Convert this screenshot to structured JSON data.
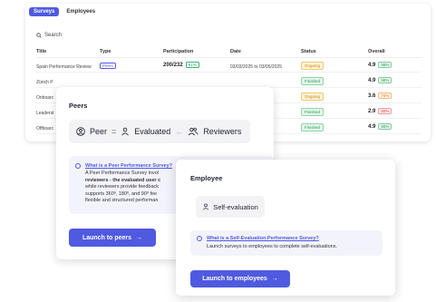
{
  "tabs": [
    "Surveys",
    "Employees"
  ],
  "search": {
    "label": "Search"
  },
  "table": {
    "columns": [
      "Title",
      "Type",
      "Participation",
      "Date",
      "Status",
      "Overall"
    ],
    "rows": [
      {
        "title": "Spain Performance Review",
        "type": "Peers",
        "participation": "200/232",
        "pct": "91%",
        "date": "03/03/2025 to 03/05/2025",
        "status": "Ongoing",
        "score": "4.9",
        "score_pct": "98%"
      },
      {
        "title": "Zürich P",
        "type": "",
        "participation": "",
        "pct": "",
        "date": "",
        "status": "Finished",
        "score": "4.9",
        "score_pct": "98%"
      },
      {
        "title": "Onboarc",
        "type": "",
        "participation": "",
        "pct": "",
        "date": "",
        "status": "Ongoing",
        "score": "3.6",
        "score_pct": "75%"
      },
      {
        "title": "Leaderst",
        "type": "",
        "participation": "",
        "pct": "",
        "date": "",
        "status": "Finished",
        "score": "2.9",
        "score_pct": "60%"
      },
      {
        "title": "Offboarc",
        "type": "",
        "participation": "",
        "pct": "",
        "date": "",
        "status": "Finished",
        "score": "4.9",
        "score_pct": "98%"
      }
    ]
  },
  "peers": {
    "title": "Peers",
    "flow": {
      "peer": "Peer",
      "evaluated": "Evaluated",
      "reviewers": "Reviewers"
    },
    "info_title": "What is a Peer Performance Survey?",
    "info_lines": [
      "A Peer Performance Survey invol",
      "reviewers - the evaluated user c",
      "while reviewers provide feedback",
      "supports 360º, 180º, and 90º fee",
      "flexible and structured performan"
    ],
    "cta": "Launch to peers"
  },
  "employee": {
    "title": "Employee",
    "self_label": "Self-evaluation",
    "info_title": "What is a Self-Evaluation Performance Survey?",
    "info_text": "Launch surveys to employees to complete self-evaluations.",
    "cta": "Launch to employees"
  },
  "colors": {
    "accent": "#4f5ae0",
    "success": "#2b9b56",
    "warning": "#c7861a",
    "danger": "#d44545"
  },
  "icons": [
    "search-icon",
    "person-icon",
    "people-icon",
    "arrow-right-icon",
    "arrow-left-icon",
    "info-icon"
  ]
}
